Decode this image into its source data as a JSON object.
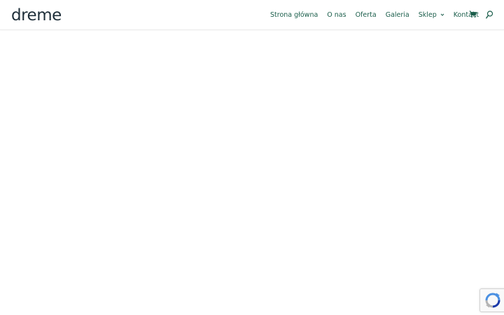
{
  "header": {
    "logo_text": "dreme"
  },
  "nav": {
    "items": [
      {
        "label": "Strona główna"
      },
      {
        "label": "O nas"
      },
      {
        "label": "Oferta"
      },
      {
        "label": "Galeria"
      },
      {
        "label": "Sklep",
        "has_dropdown": true
      },
      {
        "label": "Kontakt"
      }
    ],
    "color": "#1b5e4b"
  },
  "icons": {
    "cart": "shopping-cart-icon",
    "search": "search-icon",
    "recaptcha": "recaptcha-icon"
  },
  "colors": {
    "logo": "#1f2f3a",
    "nav_text": "#1b5e4b",
    "background": "#ffffff"
  }
}
